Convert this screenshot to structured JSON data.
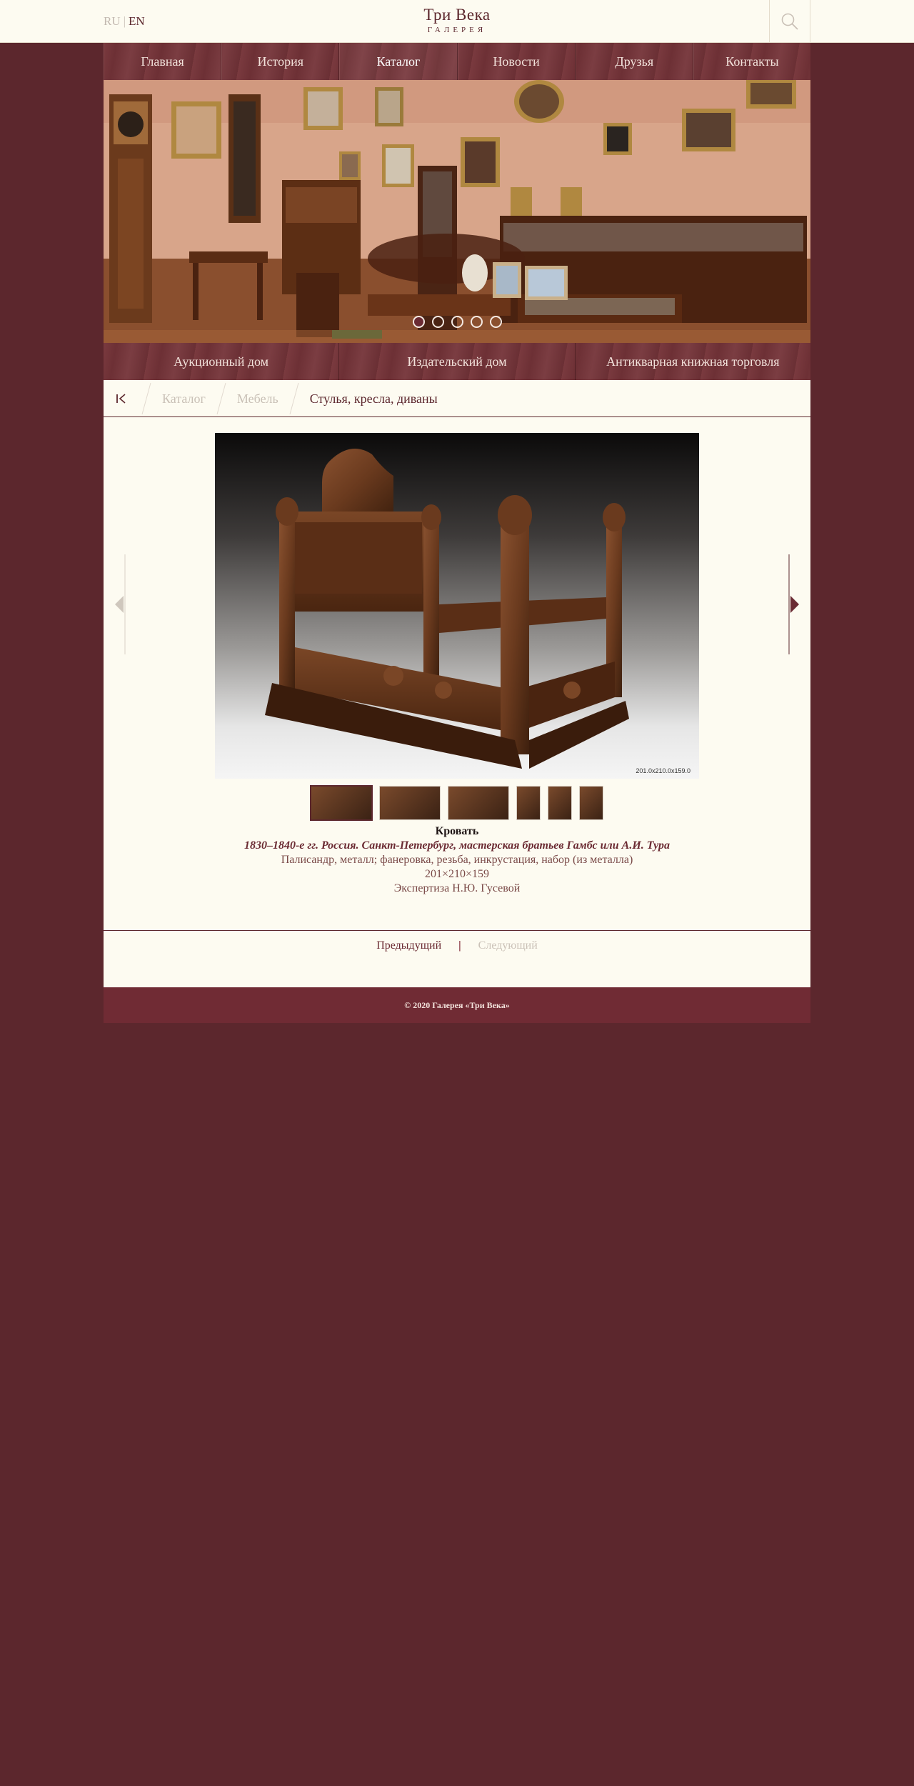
{
  "header": {
    "lang": {
      "ru": "RU",
      "separator": "|",
      "en": "EN"
    },
    "logo": {
      "line1": "Три Века",
      "line2": "ГАЛЕРЕЯ"
    },
    "search_icon": "search-icon"
  },
  "nav": {
    "items": [
      {
        "label": "Главная"
      },
      {
        "label": "История"
      },
      {
        "label": "Каталог"
      },
      {
        "label": "Новости"
      },
      {
        "label": "Друзья"
      },
      {
        "label": "Контакты"
      }
    ],
    "active": "Каталог"
  },
  "hero": {
    "slide_count": 5,
    "active_slide": 1
  },
  "subnav": {
    "items": [
      {
        "label": "Аукционный дом"
      },
      {
        "label": "Издательский дом"
      },
      {
        "label": "Антикварная книжная торговля"
      }
    ]
  },
  "breadcrumb": {
    "home_icon": "first-page-icon",
    "items": [
      {
        "label": "Каталог"
      },
      {
        "label": "Мебель"
      },
      {
        "label": "Стулья, кресла, диваны"
      }
    ]
  },
  "gallery": {
    "dimensions_label": "201.0x210.0x159.0",
    "prev_icon": "arrow-left-icon",
    "next_icon": "arrow-right-icon",
    "thumbnail_count": 6,
    "active_thumbnail": 1
  },
  "item": {
    "title": "Кровать",
    "origin": "1830–1840-е гг. Россия. Санкт-Петербург, мастерская братьев Гамбс или А.И. Тура",
    "materials": "Палисандр, металл; фанеровка, резьба, инкрустация, набор (из металла)",
    "size": "201×210×159",
    "expertise": "Экспертиза Н.Ю. Гусевой"
  },
  "pager": {
    "prev": "Предыдущий",
    "separator": "|",
    "next": "Следующий"
  },
  "footer": {
    "copyright": "© 2020 Галерея «Три Века»"
  },
  "colors": {
    "page_bg": "#5c272d",
    "panel_bg": "#fdfbf1",
    "accent": "#702b34"
  }
}
